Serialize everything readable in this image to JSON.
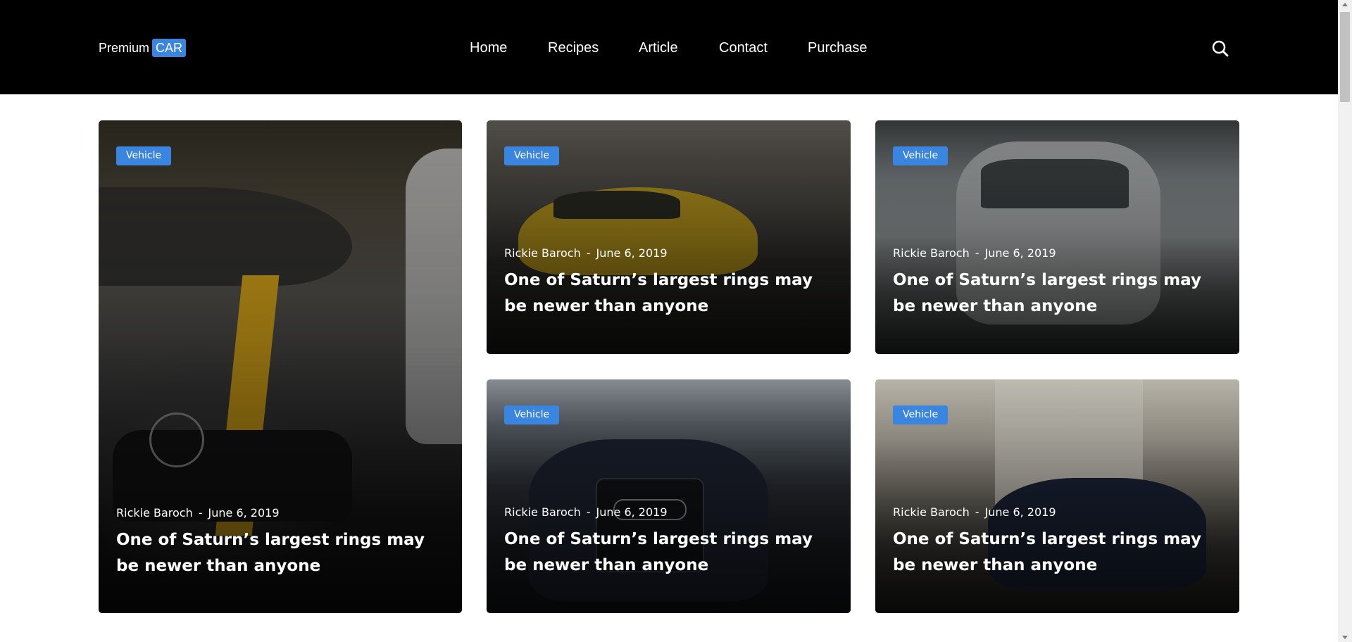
{
  "brand": {
    "prefix": "Premium",
    "badge": "CAR"
  },
  "nav": [
    "Home",
    "Recipes",
    "Article",
    "Contact",
    "Purchase"
  ],
  "colors": {
    "accent": "#3a85e0",
    "header_bg": "#000000"
  },
  "posts": [
    {
      "tag": "Vehicle",
      "author": "Rickie Baroch",
      "separator": "-",
      "date": "June 6, 2019",
      "title": "One of Saturn’s largest rings may be newer than anyone"
    },
    {
      "tag": "Vehicle",
      "author": "Rickie Baroch",
      "separator": "-",
      "date": "June 6, 2019",
      "title": "One of Saturn’s largest rings may be newer than anyone"
    },
    {
      "tag": "Vehicle",
      "author": "Rickie Baroch",
      "separator": "-",
      "date": "June 6, 2019",
      "title": "One of Saturn’s largest rings may be newer than anyone"
    },
    {
      "tag": "Vehicle",
      "author": "Rickie Baroch",
      "separator": "-",
      "date": "June 6, 2019",
      "title": "One of Saturn’s largest rings may be newer than anyone"
    },
    {
      "tag": "Vehicle",
      "author": "Rickie Baroch",
      "separator": "-",
      "date": "June 6, 2019",
      "title": "One of Saturn’s largest rings may be newer than anyone"
    }
  ]
}
